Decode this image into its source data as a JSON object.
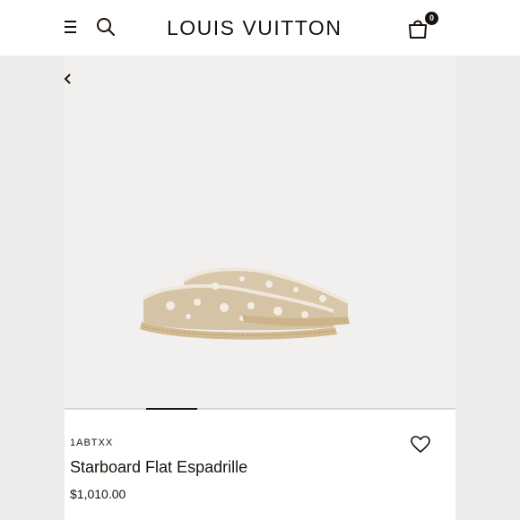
{
  "header": {
    "brand": "LOUIS VUITTON",
    "bag_count": "0",
    "icons": {
      "menu": "menu-icon",
      "search": "search-icon",
      "bag": "shopping-bag-icon"
    }
  },
  "gallery": {
    "back_icon": "chevron-left-icon",
    "active_slide": 1,
    "slide_count": 6
  },
  "product": {
    "sku": "1ABTXX",
    "title": "Starboard Flat Espadrille",
    "price": "$1,010.00",
    "wishlist_icon": "heart-icon"
  },
  "colors": {
    "text": "#19110b",
    "background": "#f1f0ef",
    "canvas": "#ffffff",
    "shoe_canvas": "#d8c7ab",
    "monogram": "#f4efe6",
    "jute": "#d2b98f"
  }
}
